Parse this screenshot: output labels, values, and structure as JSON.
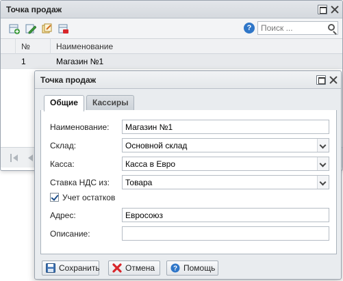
{
  "parent_window": {
    "title": "Точка продаж",
    "toolbar_icons": [
      "add-icon",
      "edit-icon",
      "copy-icon",
      "delete-icon"
    ],
    "search": {
      "placeholder": "Поиск ...",
      "value": ""
    },
    "grid": {
      "columns": [
        "№",
        "Наименование"
      ],
      "rows": [
        [
          "1",
          "Магазин №1"
        ]
      ]
    }
  },
  "dialog": {
    "title": "Точка продаж",
    "tabs": [
      "Общие",
      "Кассиры"
    ],
    "active_tab": "Общие",
    "fields": {
      "name": {
        "label": "Наименование:",
        "value": "Магазин №1"
      },
      "warehouse": {
        "label": "Склад:",
        "value": "Основной склад"
      },
      "cashbox": {
        "label": "Касса:",
        "value": "Касса в Евро"
      },
      "vat": {
        "label": "Ставка НДС из:",
        "value": "Товара"
      },
      "stock": {
        "label": "Учет остатков",
        "checked": true
      },
      "address": {
        "label": "Адрес:",
        "value": "Евросоюз"
      },
      "description": {
        "label": "Описание:",
        "value": ""
      }
    },
    "buttons": {
      "save": "Сохранить",
      "cancel": "Отмена",
      "help": "Помощь"
    }
  },
  "colors": {
    "accent": "#2f76c8",
    "cancel": "#d8262b",
    "selected_row": "#e7e9ec"
  }
}
